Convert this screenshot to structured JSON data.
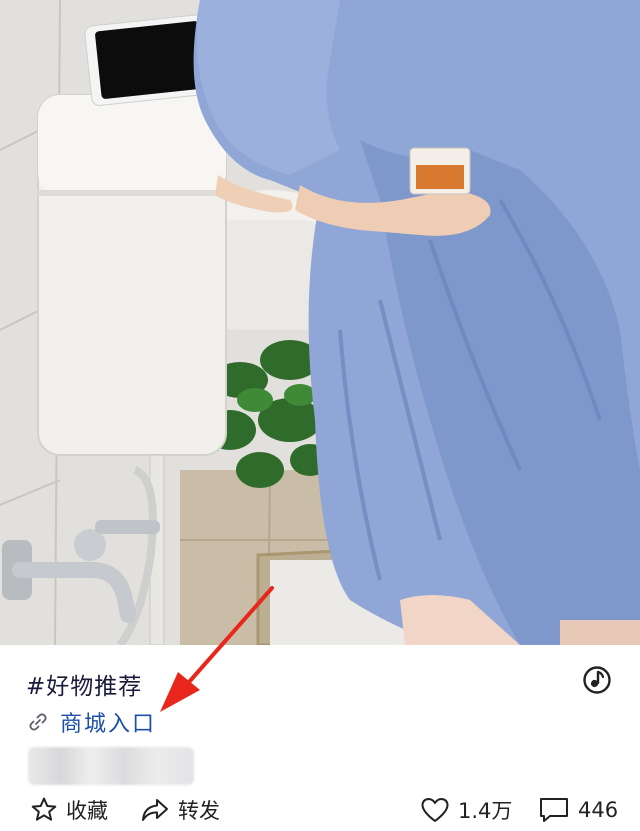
{
  "post": {
    "hashtag": "#好物推荐",
    "shop_link_label": "商城入口"
  },
  "actions": {
    "favorite_label": "收藏",
    "share_label": "转发",
    "like_count": "1.4万",
    "comment_count": "446"
  },
  "icons": {
    "music": "music-note-icon",
    "link": "link-icon",
    "favorite": "star-icon",
    "share": "share-arrow-icon",
    "like": "heart-icon",
    "comment": "comment-bubble-icon"
  },
  "colors": {
    "link_blue": "#1c4fa8",
    "annotation_red": "#e8261c",
    "dress_blue": "#8fa6d6"
  }
}
